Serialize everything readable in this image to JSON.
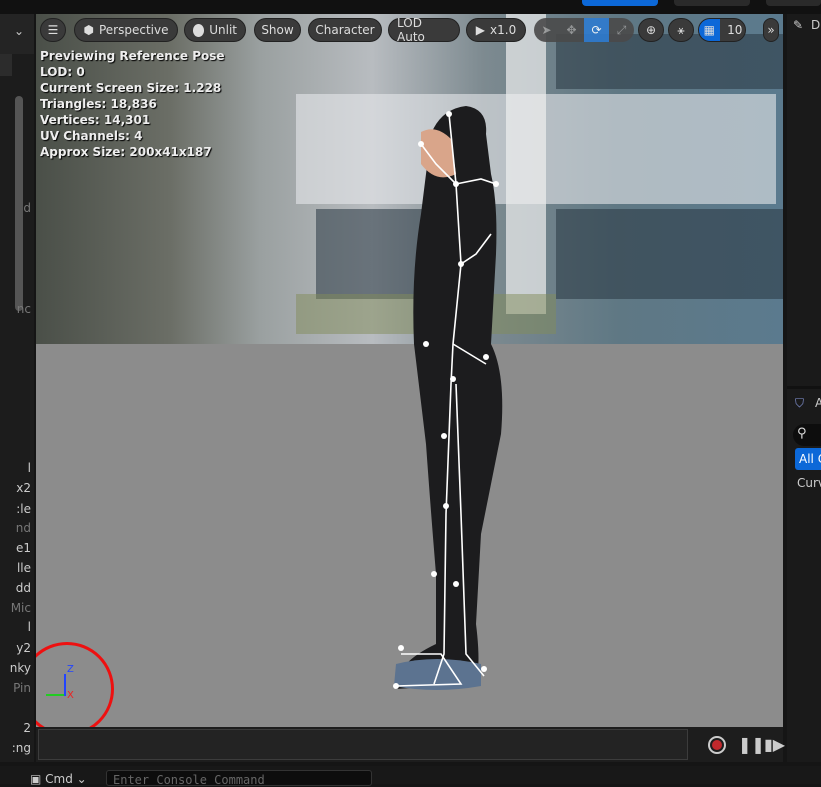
{
  "viewport_toolbar": {
    "menu_icon": "hamburger-icon",
    "perspective": "Perspective",
    "lighting": "Unlit",
    "show": "Show",
    "character": "Character",
    "lod": "LOD Auto",
    "playback_speed": "x1.0",
    "grid_snap_value": "10"
  },
  "stats": {
    "line1": "Previewing Reference Pose",
    "line2": "LOD: 0",
    "line3": "Current Screen Size: 1.228",
    "line4": "Triangles: 18,836",
    "line5": "Vertices: 14,301",
    "line6": "UV Channels: 4",
    "line7": "Approx Size: 200x41x187"
  },
  "axes": {
    "z": "Z",
    "x": "X"
  },
  "left_panel": {
    "rows": [
      "d",
      "nc",
      "l",
      "x2",
      "le:",
      "nd",
      "e1",
      "lle",
      "dd",
      "Mic",
      "l",
      "y2",
      "nky",
      "Pin",
      "2",
      "ng:"
    ]
  },
  "right_panel": {
    "tab_a": "A",
    "all_button": "All C",
    "curves": "Curv",
    "d_label": "D"
  },
  "console": {
    "cmd_label": "Cmd",
    "placeholder": "Enter Console Command"
  },
  "colors": {
    "accent": "#0c68d8",
    "highlight_circle": "#ee1010",
    "ground": "#8c8c8c"
  }
}
